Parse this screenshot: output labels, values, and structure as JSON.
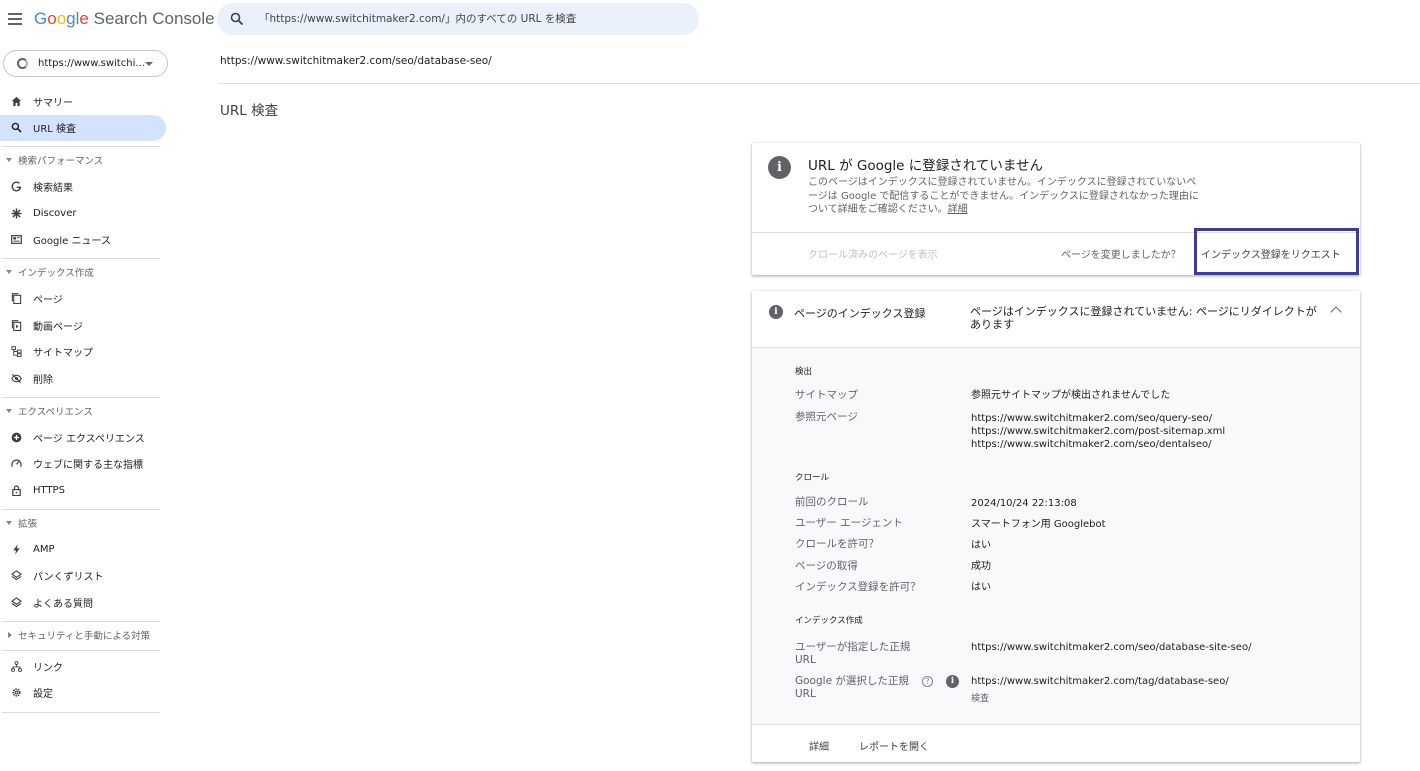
{
  "app": {
    "logo_google": [
      "G",
      "o",
      "o",
      "g",
      "l",
      "e"
    ],
    "logo_product": "Search Console"
  },
  "search": {
    "placeholder": "「https://www.switchitmaker2.com/」内のすべての URL を検査"
  },
  "property": {
    "label": "https://www.switchi..."
  },
  "sidebar": {
    "summary": "サマリー",
    "url_inspection": "URL 検査",
    "sec_performance": "検索パフォーマンス",
    "search_results": "検索結果",
    "discover": "Discover",
    "google_news": "Google ニュース",
    "sec_indexing": "インデックス作成",
    "pages": "ページ",
    "video_pages": "動画ページ",
    "sitemaps": "サイトマップ",
    "removals": "削除",
    "sec_experience": "エクスペリエンス",
    "page_experience": "ページ エクスペリエンス",
    "web_vitals": "ウェブに関する主な指標",
    "https": "HTTPS",
    "sec_enhancements": "拡張",
    "amp": "AMP",
    "breadcrumbs": "パンくずリスト",
    "faq": "よくある質問",
    "sec_security": "セキュリティと手動による対策",
    "links": "リンク",
    "settings": "設定"
  },
  "main": {
    "inspected_url": "https://www.switchitmaker2.com/seo/database-seo/",
    "page_title": "URL 検査"
  },
  "status_card": {
    "title": "URL が Google に登録されていません",
    "description": "このページはインデックスに登録されていません。インデックスに登録されていないページは Google で配信することができません。インデックスに登録されなかった理由について詳細をご確認ください。",
    "details_link": "詳細",
    "view_crawled": "クロール済みのページを表示",
    "page_changed": "ページを変更しましたか？",
    "request_indexing": "インデックス登録をリクエスト"
  },
  "index_card": {
    "label": "ページのインデックス登録",
    "status": "ページはインデックスに登録されていません: ページにリダイレクトがあります",
    "discovery_heading": "検出",
    "sitemaps_label": "サイトマップ",
    "sitemaps_value": "参照元サイトマップが検出されませんでした",
    "referring_label": "参照元ページ",
    "referring_pages": [
      "https://www.switchitmaker2.com/seo/query-seo/",
      "https://www.switchitmaker2.com/post-sitemap.xml",
      "https://www.switchitmaker2.com/seo/dentalseo/"
    ],
    "crawl_heading": "クロール",
    "last_crawl_label": "前回のクロール",
    "last_crawl_value": "2024/10/24 22:13:08",
    "user_agent_label": "ユーザー エージェント",
    "user_agent_value": "スマートフォン用 Googlebot",
    "crawl_allowed_label": "クロールを許可？",
    "crawl_allowed_value": "はい",
    "page_fetch_label": "ページの取得",
    "page_fetch_value": "成功",
    "indexing_allowed_label": "インデックス登録を許可？",
    "indexing_allowed_value": "はい",
    "indexing_heading": "インデックス作成",
    "user_canonical_label_1": "ユーザーが指定した正規",
    "user_canonical_label_2": "URL",
    "user_canonical_value": "https://www.switchitmaker2.com/seo/database-site-seo/",
    "google_canonical_label_1": "Google が選択した正規",
    "google_canonical_label_2": "URL",
    "google_canonical_value": "https://www.switchitmaker2.com/tag/database-seo/",
    "inspect_link": "検査",
    "footer_details": "詳細",
    "footer_open_report": "レポートを開く"
  }
}
